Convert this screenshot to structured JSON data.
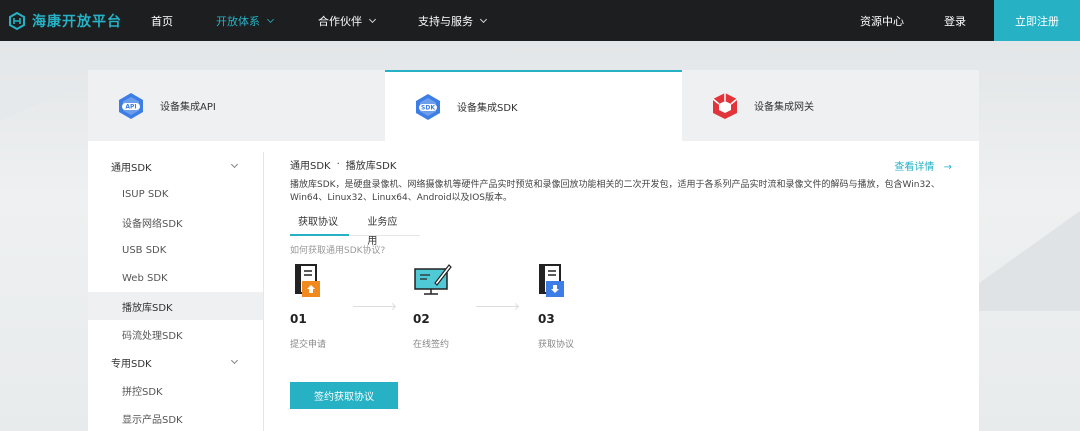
{
  "brand": {
    "name": "海康开放平台",
    "accent": "#26b2c4"
  },
  "nav": {
    "items": [
      {
        "label": "首页",
        "dropdown": false,
        "active": false
      },
      {
        "label": "开放体系",
        "dropdown": true,
        "active": true
      },
      {
        "label": "合作伙伴",
        "dropdown": true,
        "active": false
      },
      {
        "label": "支持与服务",
        "dropdown": true,
        "active": false
      }
    ],
    "resource_center": "资源中心",
    "login": "登录",
    "register": "立即注册"
  },
  "product_tabs": [
    {
      "label": "设备集成API",
      "icon": "api-hexagon-icon",
      "active": false
    },
    {
      "label": "设备集成SDK",
      "icon": "sdk-hexagon-icon",
      "active": true
    },
    {
      "label": "设备集成网关",
      "icon": "gateway-cube-icon",
      "active": false
    }
  ],
  "sidebar": {
    "groups": [
      {
        "label": "通用SDK",
        "items": [
          "ISUP SDK",
          "设备网络SDK",
          "USB SDK",
          "Web SDK",
          "播放库SDK",
          "码流处理SDK"
        ]
      },
      {
        "label": "专用SDK",
        "items": [
          "拼控SDK",
          "显示产品SDK"
        ]
      }
    ],
    "active_item": "播放库SDK"
  },
  "content": {
    "breadcrumb_parent": "通用SDK",
    "breadcrumb_sep": "·",
    "breadcrumb_current": "播放库SDK",
    "more_link": "查看详情",
    "description": "播放库SDK，是硬盘录像机、网络摄像机等硬件产品实时预览和录像回放功能相关的二次开发包，适用于各系列产品实时流和录像文件的解码与播放，包含Win32、Win64、Linux32、Linux64、Android以及IOS版本。",
    "subtabs": [
      {
        "label": "获取协议",
        "active": true
      },
      {
        "label": "业务应用",
        "active": false
      }
    ],
    "hint": "如何获取通用SDK协议?",
    "steps": [
      {
        "num": "01",
        "label": "提交申请",
        "icon": "document-upload-icon"
      },
      {
        "num": "02",
        "label": "在线签约",
        "icon": "monitor-sign-icon"
      },
      {
        "num": "03",
        "label": "获取协议",
        "icon": "document-download-icon"
      }
    ],
    "cta": "签约获取协议"
  }
}
